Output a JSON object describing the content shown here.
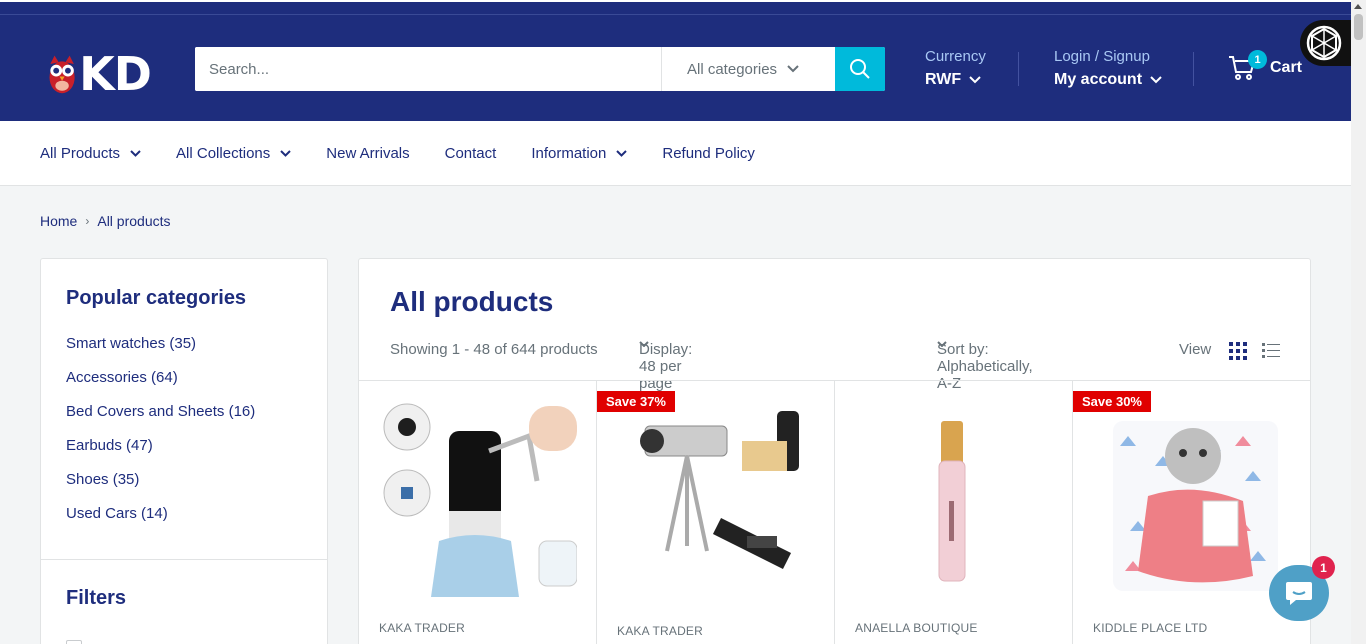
{
  "header": {
    "logo_text": "KD",
    "search": {
      "placeholder": "Search...",
      "category": "All categories"
    },
    "currency": {
      "label": "Currency",
      "value": "RWF"
    },
    "account": {
      "label": "Login / Signup",
      "value": "My account"
    },
    "cart": {
      "label": "Cart",
      "count": "1"
    }
  },
  "nav": {
    "items": [
      {
        "label": "All Products",
        "dropdown": true
      },
      {
        "label": "All Collections",
        "dropdown": true
      },
      {
        "label": "New Arrivals",
        "dropdown": false
      },
      {
        "label": "Contact",
        "dropdown": false
      },
      {
        "label": "Information",
        "dropdown": true
      },
      {
        "label": "Refund Policy",
        "dropdown": false
      }
    ]
  },
  "breadcrumb": {
    "home": "Home",
    "current": "All products"
  },
  "sidebar": {
    "title": "Popular categories",
    "categories": [
      "Smart watches (35)",
      "Accessories (64)",
      "Bed Covers and Sheets (16)",
      "Earbuds (47)",
      "Shoes (35)",
      "Used Cars (14)"
    ],
    "filters_title": "Filters"
  },
  "main": {
    "title": "All products",
    "showing": "Showing 1 - 48 of 644 products",
    "display": "Display: 48 per page",
    "sort": "Sort by: Alphabetically, A-Z",
    "view_label": "View"
  },
  "products": [
    {
      "vendor": "KAKA TRADER",
      "badge": ""
    },
    {
      "vendor": "KAKA TRADER",
      "badge": "Save 37%"
    },
    {
      "vendor": "ANAELLA BOUTIQUE",
      "badge": ""
    },
    {
      "vendor": "KIDDLE PLACE LTD",
      "badge": "Save 30%"
    }
  ],
  "chat": {
    "count": "1"
  },
  "colors": {
    "brand": "#1e2d7d",
    "accent": "#00badb",
    "sale": "#e00000"
  }
}
